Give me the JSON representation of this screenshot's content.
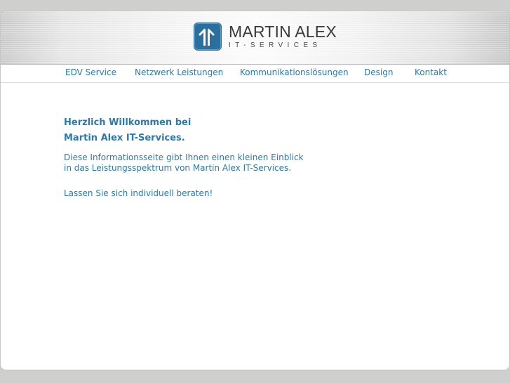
{
  "brand": {
    "name": "MARTIN ALEX",
    "tagline": "IT-SERVICES",
    "logo_icon": "arrows-up-logo-icon",
    "color_logo": "#2b6f9e"
  },
  "nav": {
    "items": [
      {
        "label": "EDV Service"
      },
      {
        "label": "Netzwerk Leistungen"
      },
      {
        "label": "Kommunikationslösungen"
      },
      {
        "label": "Design"
      },
      {
        "label": "Kontakt"
      }
    ]
  },
  "main": {
    "headline_line1": "Herzlich Willkommen bei",
    "headline_line2": "Martin Alex IT-Services.",
    "intro_line1": "Diese Informationsseite gibt Ihnen einen kleinen Einblick",
    "intro_line2": "in das Leistungsspektrum von Martin Alex IT-Services.",
    "cta": "Lassen Sie sich individuell beraten!"
  },
  "colors": {
    "text_accent": "#2a7ab0",
    "background": "#cfcfcd",
    "page": "#ffffff"
  }
}
